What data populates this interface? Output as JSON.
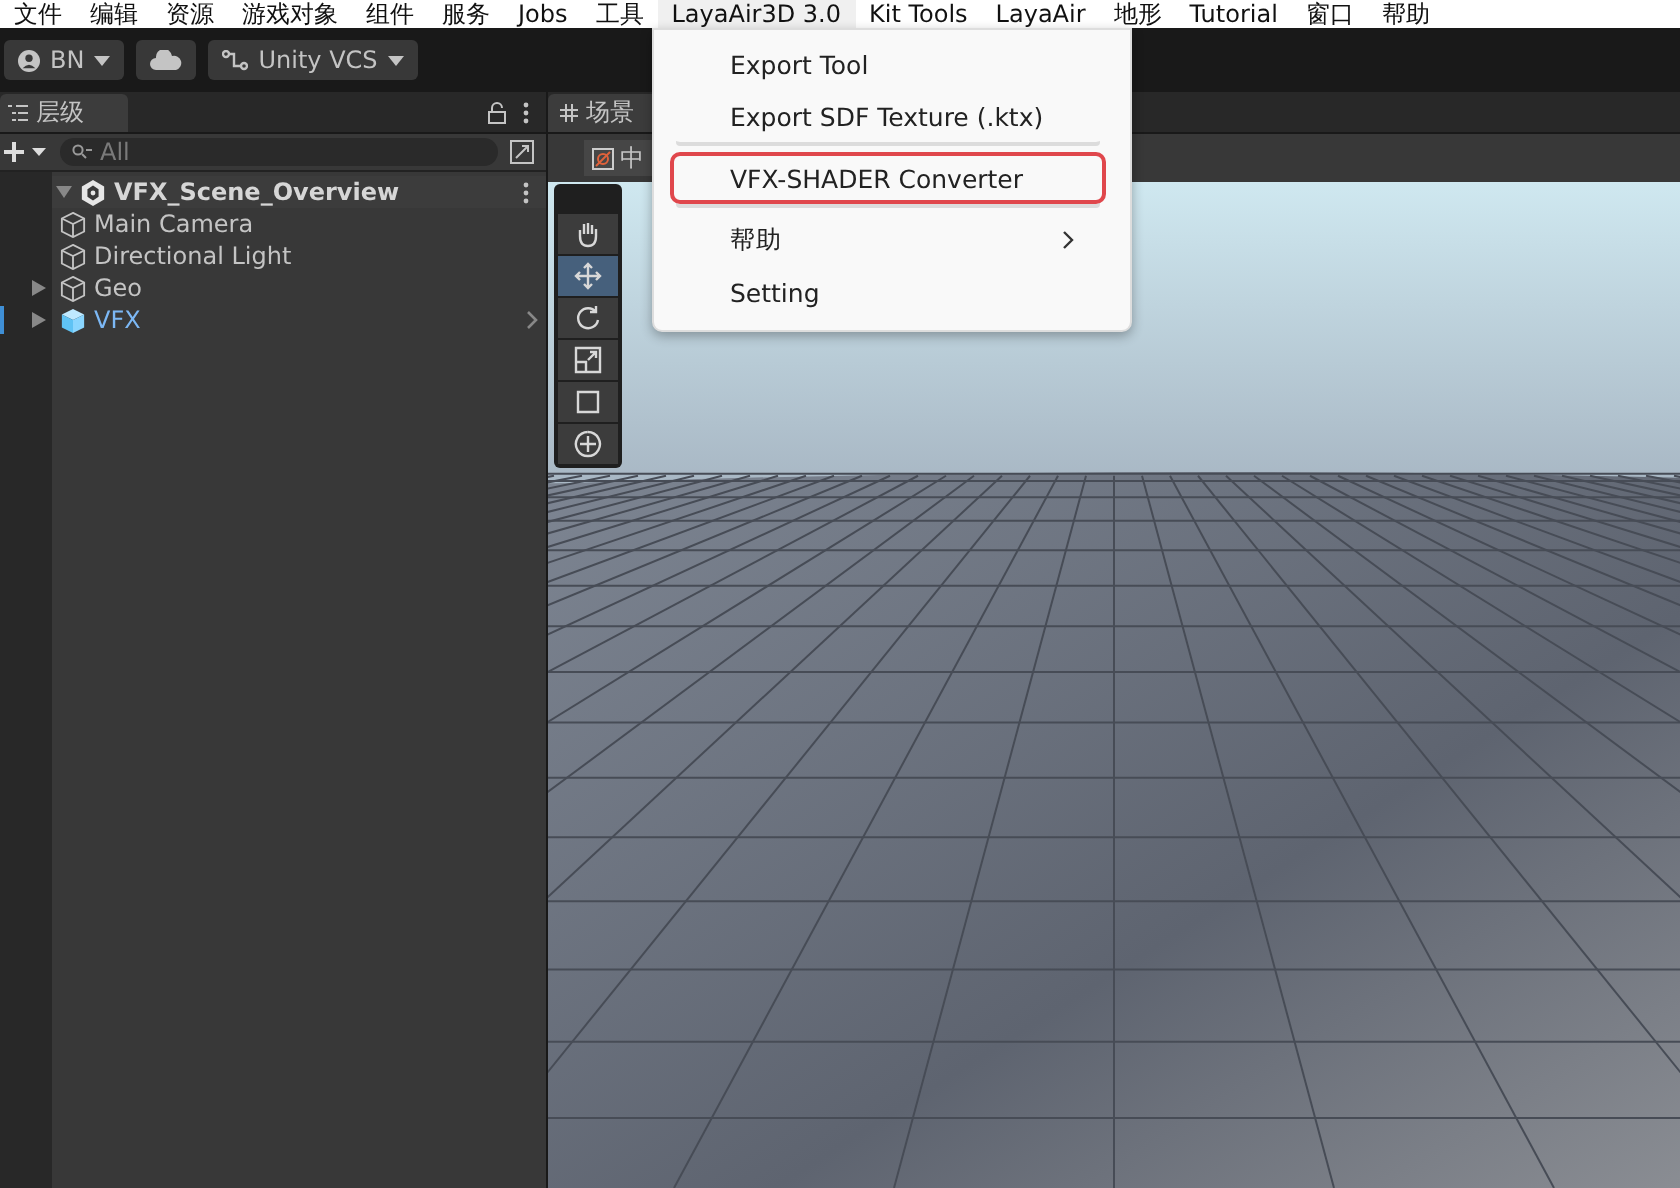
{
  "menu_bar": [
    {
      "label": "文件",
      "selected": false
    },
    {
      "label": "编辑",
      "selected": false
    },
    {
      "label": "资源",
      "selected": false
    },
    {
      "label": "游戏对象",
      "selected": false
    },
    {
      "label": "组件",
      "selected": false
    },
    {
      "label": "服务",
      "selected": false
    },
    {
      "label": "Jobs",
      "selected": false
    },
    {
      "label": "工具",
      "selected": false
    },
    {
      "label": "LayaAir3D 3.0",
      "selected": true
    },
    {
      "label": "Kit Tools",
      "selected": false
    },
    {
      "label": "LayaAir",
      "selected": false
    },
    {
      "label": "地形",
      "selected": false
    },
    {
      "label": "Tutorial",
      "selected": false
    },
    {
      "label": "窗口",
      "selected": false
    },
    {
      "label": "帮助",
      "selected": false
    }
  ],
  "dropdown": [
    {
      "label": "Export Tool",
      "highlighted": false,
      "has_submenu": false,
      "divider_after": false
    },
    {
      "label": "Export SDF Texture (.ktx)",
      "highlighted": false,
      "has_submenu": false,
      "divider_after": true
    },
    {
      "label": "VFX-SHADER Converter",
      "highlighted": true,
      "has_submenu": false,
      "divider_after": true
    },
    {
      "label": "帮助",
      "highlighted": false,
      "has_submenu": true,
      "divider_after": false
    },
    {
      "label": "Setting",
      "highlighted": false,
      "has_submenu": false,
      "divider_after": false
    }
  ],
  "toolbar": {
    "account": "BN",
    "vcs": "Unity VCS"
  },
  "hierarchy": {
    "tab": "层级",
    "search": {
      "placeholder": "All"
    },
    "root": {
      "label": "VFX_Scene_Overview",
      "expanded": true,
      "children": [
        {
          "label": "Main Camera",
          "kind": "object",
          "expandable": false
        },
        {
          "label": "Directional Light",
          "kind": "object",
          "expandable": false
        },
        {
          "label": "Geo",
          "kind": "object",
          "expandable": true
        },
        {
          "label": "VFX",
          "kind": "prefab",
          "expandable": true
        }
      ]
    }
  },
  "scene": {
    "tab": "场景",
    "toolbar_label": "中",
    "tools": [
      {
        "kind": "hand",
        "selected": false
      },
      {
        "kind": "move",
        "selected": true
      },
      {
        "kind": "rotate",
        "selected": false
      },
      {
        "kind": "scale",
        "selected": false
      },
      {
        "kind": "rect",
        "selected": false
      },
      {
        "kind": "transform",
        "selected": false
      }
    ]
  }
}
